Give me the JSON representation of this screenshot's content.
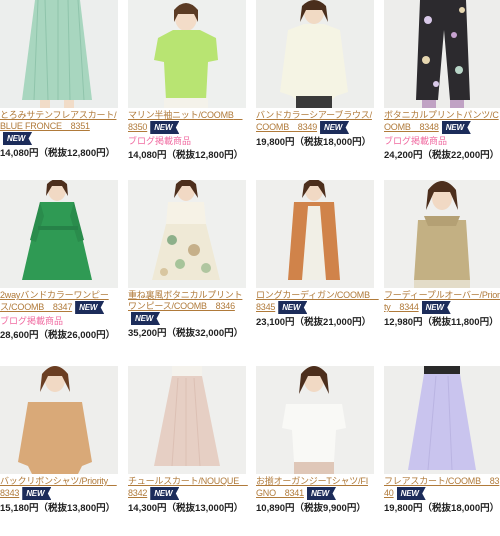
{
  "colors": {
    "link": "#b07a3a",
    "new_badge": "#1c2c5a",
    "blog_text": "#f06aa0",
    "price_text": "#222222"
  },
  "badge_new": "NEW",
  "products": [
    {
      "name": "とろみサテンフレアスカート/BLUE FRONCE　8351",
      "new": true,
      "blog": "",
      "price": "14,080円（税抜12,800円）",
      "photo": "mint-pleated-skirt"
    },
    {
      "name": "マリン半袖ニット/COOMB　8350",
      "new": true,
      "blog": "ブログ掲載商品",
      "price": "14,080円（税抜12,800円）",
      "photo": "lime-knit"
    },
    {
      "name": "バンドカラーシアーブラウス/COOMB　8349",
      "new": true,
      "blog": "",
      "price": "19,800円（税抜18,000円）",
      "photo": "sheer-blouse"
    },
    {
      "name": "ボタニカルプリントパンツ/COOMB　8348",
      "new": true,
      "blog": "ブログ掲載商品",
      "price": "24,200円（税抜22,000円）",
      "photo": "botanical-pants"
    },
    {
      "name": "2wayバンドカラーワンピース/COOMB　8347",
      "new": true,
      "blog": "ブログ掲載商品",
      "price": "28,600円（税抜26,000円）",
      "photo": "green-dress"
    },
    {
      "name": "重ね裏風ボタニカルプリントワンピース/COOMB　8346",
      "new": true,
      "blog": "",
      "price": "35,200円（税抜32,000円）",
      "photo": "botanical-dress"
    },
    {
      "name": "ロングカーディガン/COOMB　8345",
      "new": true,
      "blog": "",
      "price": "23,100円（税抜21,000円）",
      "photo": "orange-cardigan"
    },
    {
      "name": "フーディープルオーバー/Priority　8344",
      "new": true,
      "blog": "",
      "price": "12,980円（税抜11,800円）",
      "photo": "khaki-hoodie"
    },
    {
      "name": "バックリボンシャツ/Priority　8343",
      "new": true,
      "blog": "",
      "price": "15,180円（税抜13,800円）",
      "photo": "beige-shirt"
    },
    {
      "name": "チュールスカート/NOUQUE　8342",
      "new": true,
      "blog": "",
      "price": "14,300円（税抜13,000円）",
      "photo": "tulle-skirt"
    },
    {
      "name": "お揃オーガンジーTシャツ/FIGNO　8341",
      "new": true,
      "blog": "",
      "price": "10,890円（税抜9,900円）",
      "photo": "organza-tshirt"
    },
    {
      "name": "フレアスカート/COOMB　8340",
      "new": true,
      "blog": "",
      "price": "19,800円（税抜18,000円）",
      "photo": "lavender-skirt"
    }
  ]
}
